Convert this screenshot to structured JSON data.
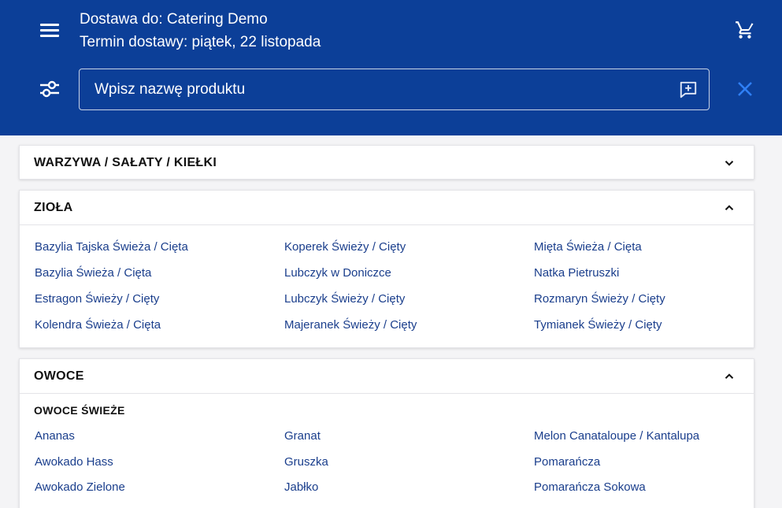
{
  "header": {
    "delivery_to": "Dostawa do: Catering Demo",
    "delivery_date": "Termin dostawy: piątek, 22 listopada",
    "search_placeholder": "Wpisz nazwę produktu",
    "icons": [
      "menu-icon",
      "cart-icon",
      "filter-icon",
      "feedback-icon",
      "close-icon"
    ]
  },
  "sections": [
    {
      "title": "WARZYWA / SAŁATY / KIEŁKI",
      "expanded": false
    },
    {
      "title": "ZIOŁA",
      "expanded": true,
      "columns": [
        [
          "Bazylia Tajska Świeża / Cięta",
          "Bazylia Świeża / Cięta",
          "Estragon Świeży / Cięty",
          "Kolendra Świeża / Cięta"
        ],
        [
          "Koperek Świeży / Cięty",
          "Lubczyk w Doniczce",
          "Lubczyk Świeży / Cięty",
          "Majeranek Świeży / Cięty"
        ],
        [
          "Mięta Świeża / Cięta",
          "Natka Pietruszki",
          "Rozmaryn Świeży / Cięty",
          "Tymianek Świeży / Cięty"
        ]
      ]
    },
    {
      "title": "OWOCE",
      "expanded": true,
      "subsection": "OWOCE ŚWIEŻE",
      "columns": [
        [
          "Ananas",
          "Awokado Hass",
          "Awokado Zielone"
        ],
        [
          "Granat",
          "Gruszka",
          "Jabłko"
        ],
        [
          "Melon Canataloupe / Kantalupa",
          "Pomarańcza",
          "Pomarańcza Sokowa"
        ]
      ]
    }
  ],
  "colors": {
    "header_bg": "#0c3f98",
    "link": "#1a3e8c",
    "page_bg": "#f4f4f6",
    "close_accent": "#2f7ff5"
  }
}
